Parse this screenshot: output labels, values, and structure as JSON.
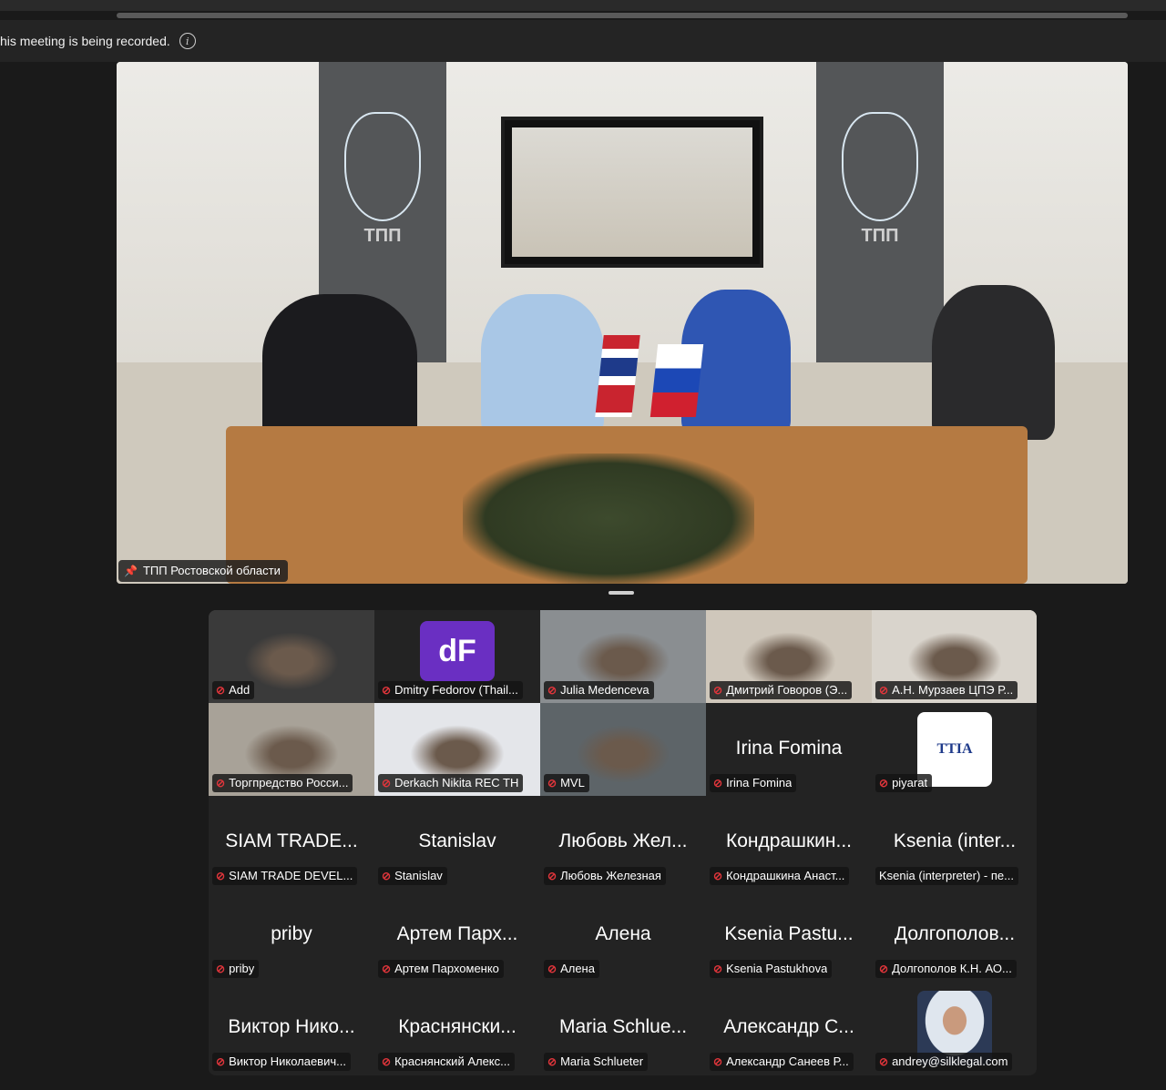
{
  "recording": {
    "text": "his meeting is being recorded.",
    "info_icon": "info-icon"
  },
  "main_video": {
    "label": "ТПП Ростовской области",
    "pin_icon": "pin-icon",
    "emblem_text": "ТПП"
  },
  "participants": [
    {
      "big": "",
      "name": "Add",
      "muted": true,
      "kind": "video",
      "bg": "#3a3a3a"
    },
    {
      "big": "",
      "name": "Dmitry Fedorov (Thail...",
      "muted": true,
      "kind": "logo",
      "bg": "#232323"
    },
    {
      "big": "",
      "name": "Julia Medenceva",
      "muted": true,
      "kind": "video",
      "bg": "#8a8e91"
    },
    {
      "big": "",
      "name": "Дмитрий Говоров (Э...",
      "muted": true,
      "kind": "video",
      "bg": "#cfc7bb"
    },
    {
      "big": "",
      "name": "А.Н. Мурзаев ЦПЭ Р...",
      "muted": true,
      "kind": "video",
      "bg": "#d9d4cc"
    },
    {
      "big": "",
      "name": "Торгпредство Росси...",
      "muted": true,
      "kind": "video",
      "bg": "#a8a298"
    },
    {
      "big": "",
      "name": "Derkach Nikita REC TH",
      "muted": true,
      "kind": "video",
      "bg": "#e4e6ea"
    },
    {
      "big": "",
      "name": "MVL",
      "muted": true,
      "kind": "video",
      "bg": "#5d6468"
    },
    {
      "big": "Irina Fomina",
      "name": "Irina Fomina",
      "muted": true,
      "kind": "text",
      "bg": "#232323"
    },
    {
      "big": "",
      "name": "piyarat",
      "muted": true,
      "kind": "ttia",
      "bg": "#232323"
    },
    {
      "big": "SIAM TRADE...",
      "name": "SIAM TRADE DEVEL...",
      "muted": true,
      "kind": "text",
      "bg": "#232323"
    },
    {
      "big": "Stanislav",
      "name": "Stanislav",
      "muted": true,
      "kind": "text",
      "bg": "#232323"
    },
    {
      "big": "Любовь Жел...",
      "name": "Любовь Железная",
      "muted": true,
      "kind": "text",
      "bg": "#232323"
    },
    {
      "big": "Кондрашкин...",
      "name": "Кондрашкина Анаст...",
      "muted": true,
      "kind": "text",
      "bg": "#232323"
    },
    {
      "big": "Ksenia (inter...",
      "name": "Ksenia (interpreter) - пе...",
      "muted": false,
      "kind": "text",
      "bg": "#232323"
    },
    {
      "big": "priby",
      "name": "priby",
      "muted": true,
      "kind": "text",
      "bg": "#232323"
    },
    {
      "big": "Артем Парх...",
      "name": "Артем Пархоменко",
      "muted": true,
      "kind": "text",
      "bg": "#232323"
    },
    {
      "big": "Алена",
      "name": "Алена",
      "muted": true,
      "kind": "text",
      "bg": "#232323"
    },
    {
      "big": "Ksenia Pastu...",
      "name": "Ksenia Pastukhova",
      "muted": true,
      "kind": "text",
      "bg": "#232323"
    },
    {
      "big": "Долгополов...",
      "name": "Долгополов К.Н. АО...",
      "muted": true,
      "kind": "text",
      "bg": "#232323"
    },
    {
      "big": "Виктор Нико...",
      "name": "Виктор Николаевич...",
      "muted": true,
      "kind": "text",
      "bg": "#232323"
    },
    {
      "big": "Краснянски...",
      "name": "Краснянский Алекс...",
      "muted": true,
      "kind": "text",
      "bg": "#232323"
    },
    {
      "big": "Maria Schlue...",
      "name": "Maria Schlueter",
      "muted": true,
      "kind": "text",
      "bg": "#232323"
    },
    {
      "big": "Александр С...",
      "name": "Александр Санеев Р...",
      "muted": true,
      "kind": "text",
      "bg": "#232323"
    },
    {
      "big": "",
      "name": "andrey@silklegal.com",
      "muted": true,
      "kind": "photo",
      "bg": "#232323"
    }
  ],
  "ttia_logo_text": "TTIA"
}
